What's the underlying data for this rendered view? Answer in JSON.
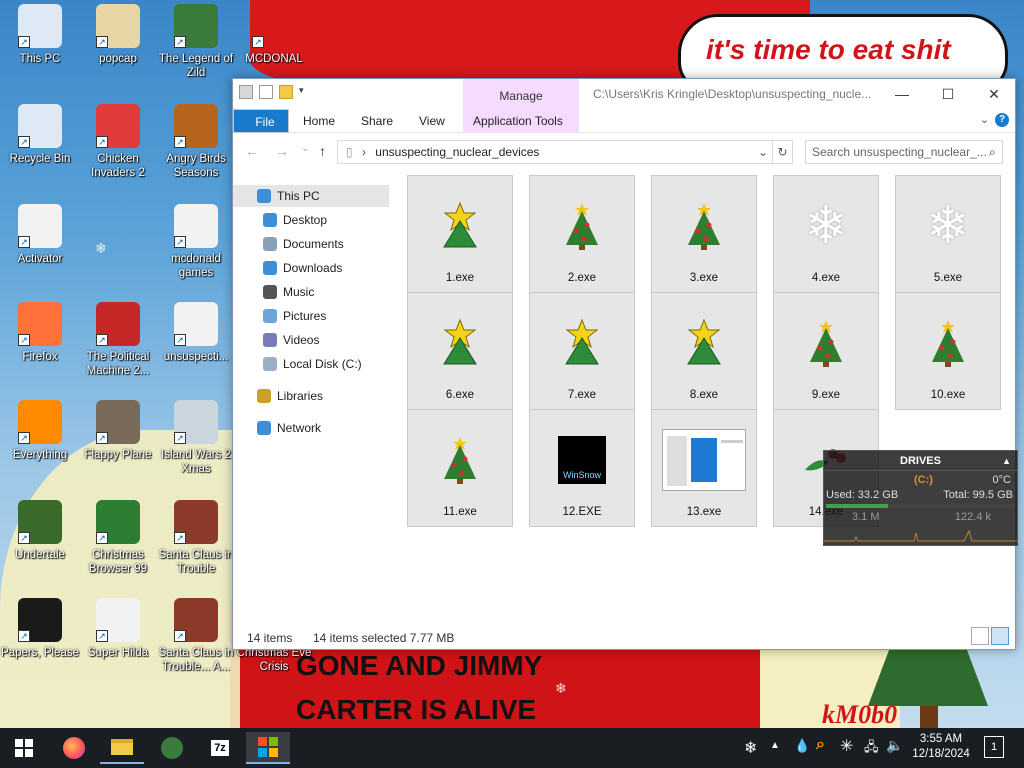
{
  "wallpaper": {
    "bubble_text": "it's time to eat shit",
    "line1": "GONE AND JIMMY",
    "line2": "CARTER IS ALIVE",
    "signature": "kM0b0"
  },
  "desktop_icons": [
    {
      "label": "This PC",
      "icon": "computer-icon",
      "color": "#dfe9f5"
    },
    {
      "label": "popcap",
      "icon": "folder-icon",
      "color": "#e8d5a6"
    },
    {
      "label": "The Legend of Zild",
      "icon": "game-icon",
      "color": "#3a7a3a"
    },
    {
      "label": "MCDONAL",
      "icon": "mcdonalds-icon",
      "color": "#d8191c"
    },
    {
      "label": "Recycle Bin",
      "icon": "recycle-bin-icon",
      "color": "#dfe9f5"
    },
    {
      "label": "Chicken Invaders 2",
      "icon": "chicken-icon",
      "color": "#e23b3b"
    },
    {
      "label": "Angry Birds Seasons",
      "icon": "angry-birds-icon",
      "color": "#b5651d"
    },
    {
      "label": "Activator",
      "icon": "file-icon",
      "color": "#f2f2f2"
    },
    {
      "label": "mcdonald games",
      "icon": "folder-icon",
      "color": "#f2f2f2"
    },
    {
      "label": "Firefox",
      "icon": "firefox-icon",
      "color": "#ff7139"
    },
    {
      "label": "The Political Machine 2...",
      "icon": "political-machine-icon",
      "color": "#c62828"
    },
    {
      "label": "unsuspecti...",
      "icon": "folder-icon",
      "color": "#f2f2f2"
    },
    {
      "label": "Everything",
      "icon": "everything-search-icon",
      "color": "#ff8a00"
    },
    {
      "label": "Flappy Plane",
      "icon": "game-icon",
      "color": "#7a6a5a"
    },
    {
      "label": "Island Wars 2 Xmas",
      "icon": "game-icon",
      "color": "#c9d6dd"
    },
    {
      "label": "Undertale",
      "icon": "undertale-icon",
      "color": "#3a6a2a"
    },
    {
      "label": "Christmas Browser 99",
      "icon": "christmas-tree-icon",
      "color": "#2e7d32"
    },
    {
      "label": "Santa Claus in Trouble",
      "icon": "santa-icon",
      "color": "#8d3a2a"
    },
    {
      "label": "Papers, Please",
      "icon": "papers-please-icon",
      "color": "#1a1a1a"
    },
    {
      "label": "Super Hilda",
      "icon": "game-icon",
      "color": "#f2f2f2"
    },
    {
      "label": "Santa Claus in Trouble... A...",
      "icon": "santa-icon",
      "color": "#8d3a2a"
    },
    {
      "label": "Christmas Eve Crisis",
      "icon": "game-icon",
      "color": "#cc2222"
    }
  ],
  "explorer": {
    "title_path": "C:\\Users\\Kris Kringle\\Desktop\\unsuspecting_nucle...",
    "manage_label": "Manage",
    "tabs": {
      "file": "File",
      "home": "Home",
      "share": "Share",
      "view": "View",
      "app_tools": "Application Tools"
    },
    "address": "unsuspecting_nuclear_devices",
    "search_placeholder": "Search unsuspecting_nuclear_...",
    "nav": [
      {
        "label": "This PC",
        "icon": "computer-icon",
        "selected": true
      },
      {
        "label": "Desktop",
        "icon": "desktop-icon"
      },
      {
        "label": "Documents",
        "icon": "documents-icon"
      },
      {
        "label": "Downloads",
        "icon": "downloads-icon"
      },
      {
        "label": "Music",
        "icon": "music-icon"
      },
      {
        "label": "Pictures",
        "icon": "pictures-icon"
      },
      {
        "label": "Videos",
        "icon": "videos-icon"
      },
      {
        "label": "Local Disk (C:)",
        "icon": "disk-icon"
      },
      {
        "label": "Libraries",
        "icon": "libraries-icon"
      },
      {
        "label": "Network",
        "icon": "network-icon"
      }
    ],
    "files": [
      {
        "name": "1.exe",
        "icon": "star-tree-icon"
      },
      {
        "name": "2.exe",
        "icon": "christmas-tree-icon"
      },
      {
        "name": "3.exe",
        "icon": "christmas-tree-icon"
      },
      {
        "name": "4.exe",
        "icon": "snowflake-icon"
      },
      {
        "name": "5.exe",
        "icon": "snowflake-icon"
      },
      {
        "name": "6.exe",
        "icon": "star-tree-icon"
      },
      {
        "name": "7.exe",
        "icon": "star-tree-icon"
      },
      {
        "name": "8.exe",
        "icon": "star-tree-icon"
      },
      {
        "name": "9.exe",
        "icon": "christmas-tree-icon"
      },
      {
        "name": "10.exe",
        "icon": "christmas-tree-icon"
      },
      {
        "name": "11.exe",
        "icon": "christmas-tree-icon"
      },
      {
        "name": "12.EXE",
        "icon": "winsnow-icon"
      },
      {
        "name": "13.exe",
        "icon": "window-thumbnail-icon"
      },
      {
        "name": "14.exe",
        "icon": "holly-icon"
      }
    ],
    "status_count": "14 items",
    "status_selected": "14 items selected  7.77 MB"
  },
  "drives_widget": {
    "title": "DRIVES",
    "drive": "(C:)",
    "temp": "0°C",
    "used": "Used: 33.2 GB",
    "total": "Total: 99.5 GB",
    "read": "3.1 M",
    "write": "122.4 k"
  },
  "taskbar": {
    "icons": [
      "windows-start-icon",
      "firefox-icon",
      "file-explorer-icon",
      "legend-of-zild-icon",
      "7zip-icon",
      "christmas-browser-icon"
    ],
    "zip_label": "7z",
    "time": "3:55 AM",
    "date": "12/18/2024",
    "notifications": "1"
  }
}
